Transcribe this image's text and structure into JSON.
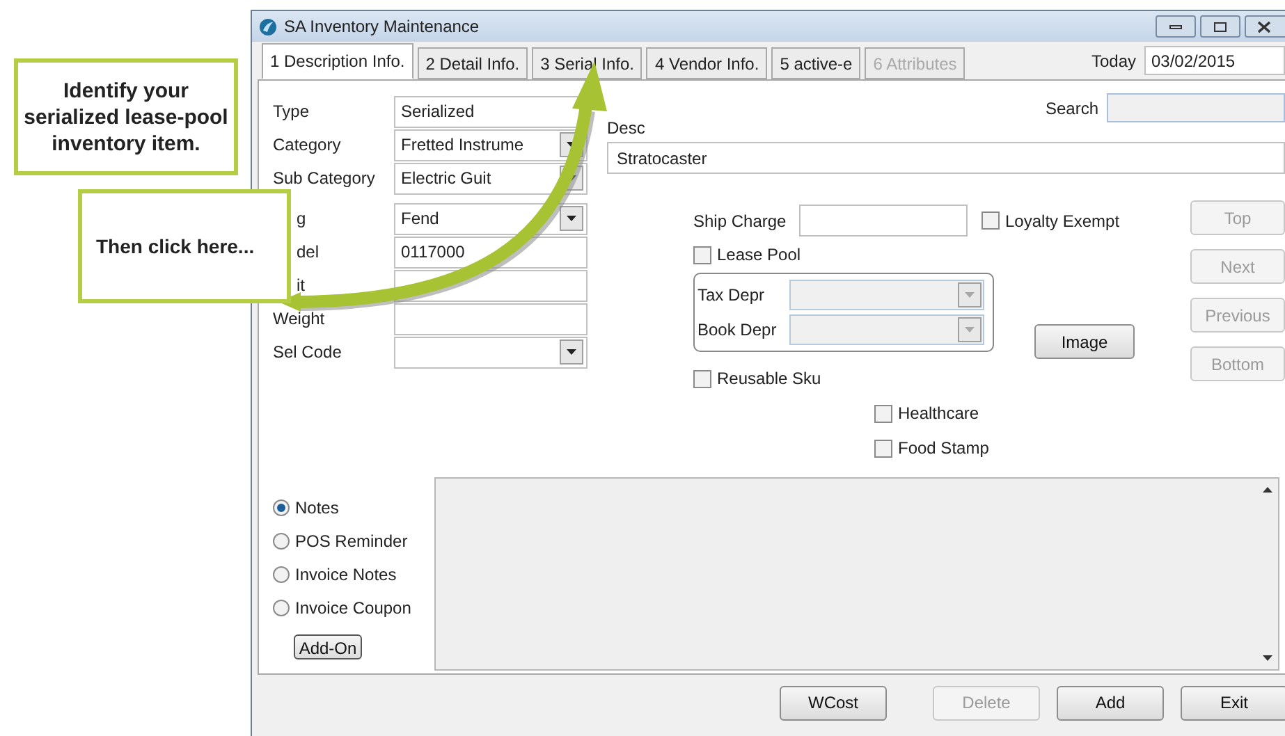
{
  "callouts": [
    {
      "text": "Identify your serialized lease-pool inventory item."
    },
    {
      "text": "Then click here..."
    }
  ],
  "window": {
    "title": "SA Inventory Maintenance"
  },
  "tabs": [
    {
      "label": "1 Description Info.",
      "selected": true,
      "disabled": false
    },
    {
      "label": "2 Detail Info.",
      "selected": false,
      "disabled": false
    },
    {
      "label": "3 Serial Info.",
      "selected": false,
      "disabled": false
    },
    {
      "label": "4 Vendor Info.",
      "selected": false,
      "disabled": false
    },
    {
      "label": "5 active-e",
      "selected": false,
      "disabled": false
    },
    {
      "label": "6 Attributes",
      "selected": false,
      "disabled": true
    }
  ],
  "today": {
    "label": "Today",
    "value": "03/02/2015"
  },
  "search": {
    "label": "Search"
  },
  "desc": {
    "label": "Desc",
    "value": "Stratocaster"
  },
  "field_groups": [
    [
      {
        "label": "Type",
        "value": "Serialized",
        "kind": "text",
        "clipped": false
      },
      {
        "label": "Category",
        "value": "Fretted Instrume",
        "kind": "dropdown",
        "clipped": false
      },
      {
        "label": "Sub Category",
        "value": "Electric Guit",
        "kind": "dropdown",
        "clipped": false
      }
    ],
    [
      {
        "label": "g",
        "value": "Fend",
        "kind": "dropdown",
        "clipped": true
      },
      {
        "label": "del",
        "value": "0117000",
        "kind": "text",
        "clipped": true
      },
      {
        "label": "it",
        "kind": "text",
        "clipped": true
      },
      {
        "label": "Weight",
        "kind": "text",
        "clipped": false
      },
      {
        "label": "Sel Code",
        "kind": "dropdown",
        "clipped": false
      }
    ]
  ],
  "ship_charge": {
    "label": "Ship Charge"
  },
  "checkboxes": {
    "loyalty_exempt": {
      "label": "Loyalty Exempt",
      "checked": false
    },
    "lease_pool": {
      "label": "Lease Pool",
      "checked": false
    },
    "reusable_sku": {
      "label": "Reusable Sku",
      "checked": false
    },
    "healthcare": {
      "label": "Healthcare",
      "checked": false
    },
    "food_stamp": {
      "label": "Food Stamp",
      "checked": false
    }
  },
  "depreciation": [
    {
      "label": "Tax Depr",
      "disabled": true
    },
    {
      "label": "Book Depr",
      "disabled": true
    }
  ],
  "image_button": "Image",
  "nav_buttons": [
    {
      "label": "Top",
      "disabled": true
    },
    {
      "label": "Next",
      "disabled": true
    },
    {
      "label": "Previous",
      "disabled": true
    },
    {
      "label": "Bottom",
      "disabled": true
    }
  ],
  "note_types": [
    {
      "label": "Notes",
      "selected": true
    },
    {
      "label": "POS Reminder",
      "selected": false
    },
    {
      "label": "Invoice Notes",
      "selected": false
    },
    {
      "label": "Invoice Coupon",
      "selected": false
    }
  ],
  "addon_button": "Add-On",
  "footer_buttons": [
    {
      "label": "WCost",
      "disabled": false
    },
    {
      "label": "Delete",
      "disabled": true
    },
    {
      "label": "Add",
      "disabled": false
    },
    {
      "label": "Exit",
      "disabled": false
    }
  ]
}
